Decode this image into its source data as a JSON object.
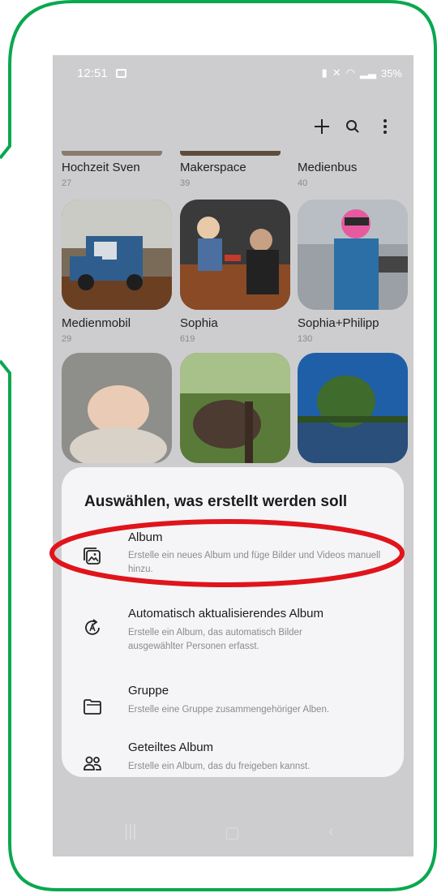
{
  "status": {
    "time": "12:51",
    "battery": "35%"
  },
  "toolbar": {
    "add_icon": "plus-icon",
    "search_icon": "search-icon",
    "more_icon": "more-vertical-icon"
  },
  "albums_top": [
    {
      "name": "Hochzeit Sven",
      "count": "27"
    },
    {
      "name": "Makerspace",
      "count": "39"
    },
    {
      "name": "Medienbus",
      "count": "40"
    }
  ],
  "albums_mid": [
    {
      "name": "Medienmobil",
      "count": "29"
    },
    {
      "name": "Sophia",
      "count": "619"
    },
    {
      "name": "Sophia+Philipp",
      "count": "130"
    }
  ],
  "sheet": {
    "title": "Auswählen, was erstellt werden soll",
    "options": [
      {
        "title": "Album",
        "desc": "Erstelle ein neues Album und füge Bilder und Videos manuell hinzu.",
        "icon": "album-icon"
      },
      {
        "title": "Automatisch aktualisierendes Album",
        "desc": "Erstelle ein Album, das automatisch Bilder ausgewählter Personen erfasst.",
        "icon": "auto-update-album-icon"
      },
      {
        "title": "Gruppe",
        "desc": "Erstelle eine Gruppe zusammengehöriger Alben.",
        "icon": "group-folder-icon"
      },
      {
        "title": "Geteiltes Album",
        "desc": "Erstelle ein Album, das du freigeben kannst.",
        "icon": "shared-album-icon"
      }
    ]
  },
  "colors": {
    "frame": "#0aa84f",
    "highlight": "#e0141b"
  }
}
